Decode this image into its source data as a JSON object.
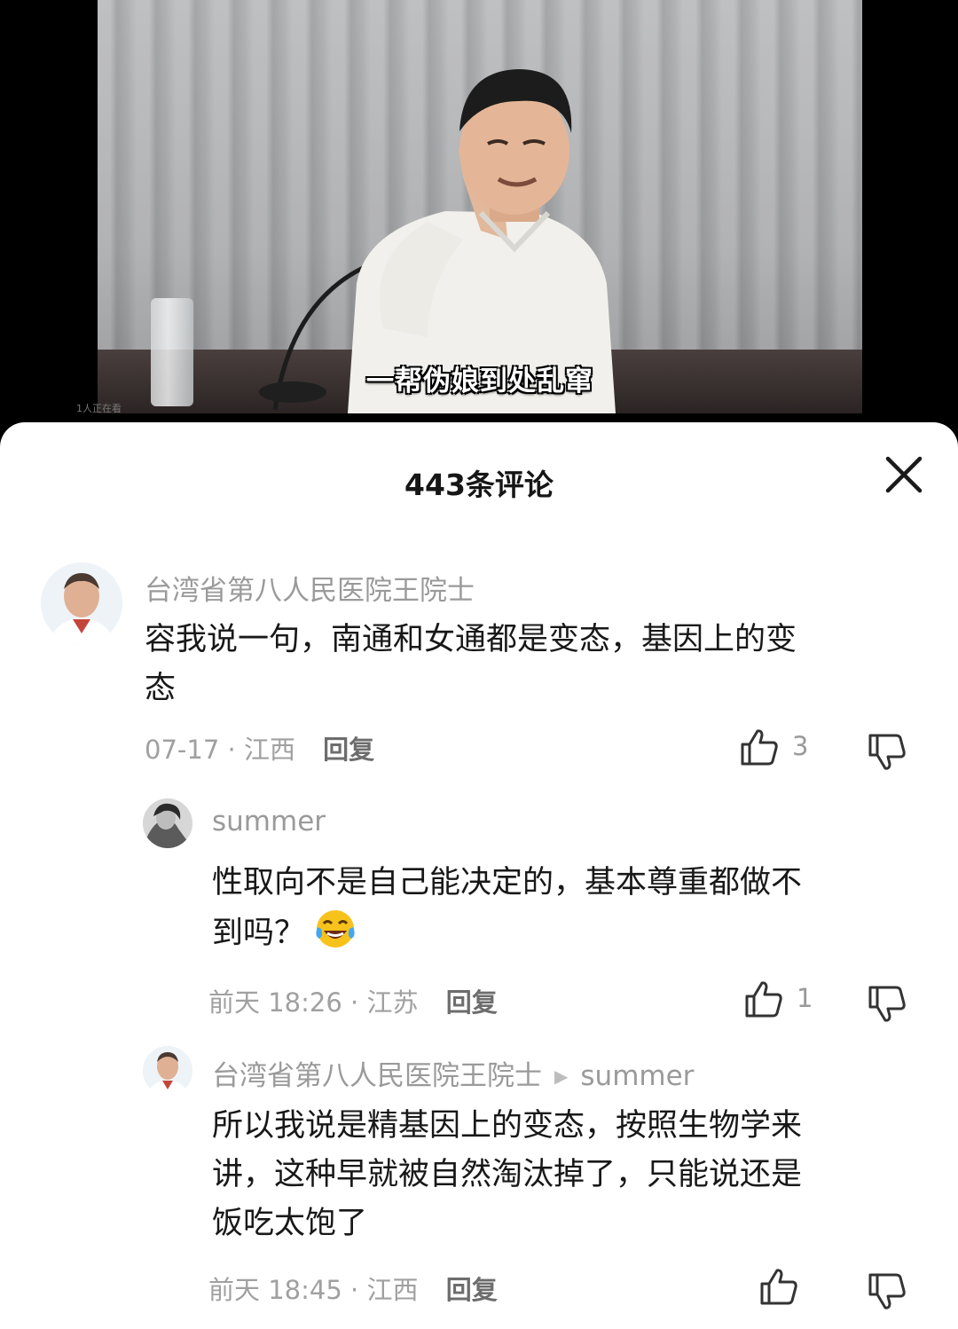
{
  "video": {
    "subtitle": "一帮伪娘到处乱窜",
    "watch_count": "1人正在看"
  },
  "sheet": {
    "title": "443条评论",
    "close_icon": "close-icon"
  },
  "comments": [
    {
      "username": "台湾省第八人民医院王院士",
      "text_line1": "容我说一句，南通和女通都是变态，基因上的变",
      "text_line2": "态",
      "date": "07-17",
      "location": "江西",
      "reply_label": "回复",
      "likes": "3"
    },
    {
      "username": "summer",
      "text_line1": "性取向不是自己能决定的，基本尊重都做不",
      "text_line2": "到吗？",
      "emoji": "laughing-tears-emoji",
      "date": "前天 18:26",
      "location": "江苏",
      "reply_label": "回复",
      "likes": "1"
    },
    {
      "username": "台湾省第八人民医院王院士",
      "reply_to": "summer",
      "text_line1": "所以我说是精基因上的变态，按照生物学来",
      "text_line2": "讲，这种早就被自然淘汰掉了，只能说还是",
      "text_line3": "饭吃太饱了",
      "date": "前天 18:45",
      "location": "江西",
      "reply_label": "回复"
    }
  ],
  "colors": {
    "sheet_bg": "#ffffff",
    "username": "#9a9a9a",
    "content": "#181818",
    "meta": "#a0a0a0"
  }
}
